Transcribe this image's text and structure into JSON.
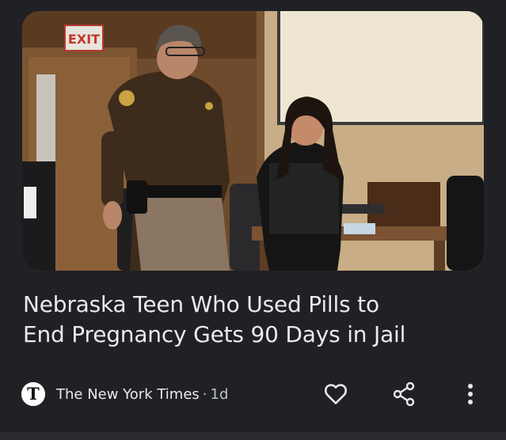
{
  "card": {
    "image_alt": "Courtroom photo",
    "exit_sign": "EXIT",
    "headline_line1": "Nebraska Teen Who Used Pills to",
    "headline_line2": "End Pregnancy Gets 90 Days in Jail",
    "source": {
      "logo_letter": "T",
      "name": "The New York Times",
      "separator": "·",
      "age": "1d"
    },
    "actions": {
      "like_icon": "heart-icon",
      "share_icon": "share-icon",
      "more_icon": "more-vert-icon"
    }
  },
  "colors": {
    "background": "#202124",
    "text_primary": "#e8eaed",
    "text_secondary": "#bdc1c6"
  }
}
